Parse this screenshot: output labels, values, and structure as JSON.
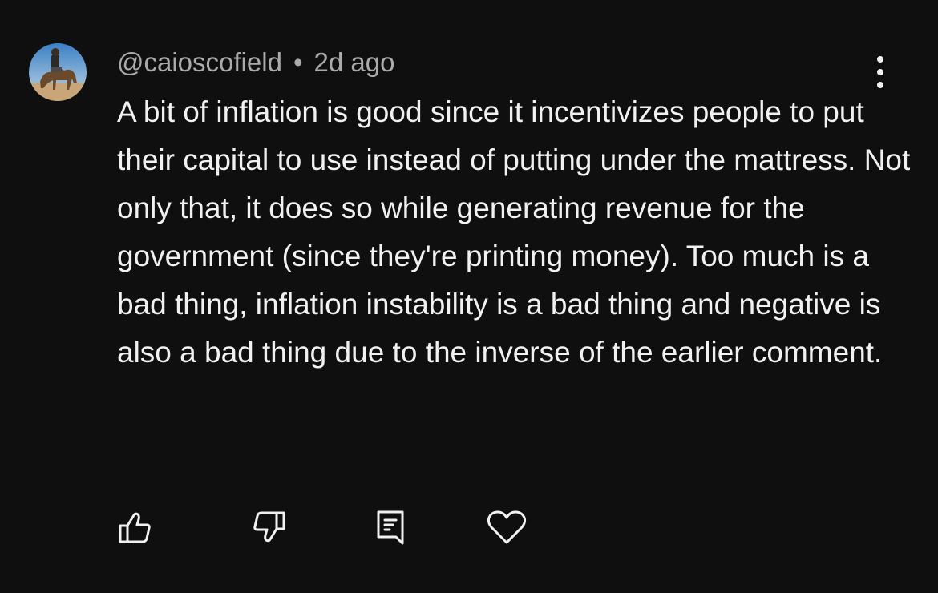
{
  "comment": {
    "author": "@caioscofield",
    "separator": "•",
    "time_ago": "2d ago",
    "text": "A bit of inflation is good since it incentivizes people to put their capital to use instead of putting under the mattress. Not only that, it does so while generating revenue for the government (since they're printing money). Too much is a bad thing, inflation instability is a bad thing and negative is also a bad thing due to the inverse of the earlier comment."
  },
  "actions": [
    {
      "icon": "thumbs-up-icon"
    },
    {
      "icon": "thumbs-down-icon"
    },
    {
      "icon": "reply-icon"
    },
    {
      "icon": "heart-icon"
    }
  ],
  "theme": {
    "background": "#0f0f0f",
    "text_primary": "#f1f1f1",
    "text_secondary": "#aaaaaa"
  }
}
